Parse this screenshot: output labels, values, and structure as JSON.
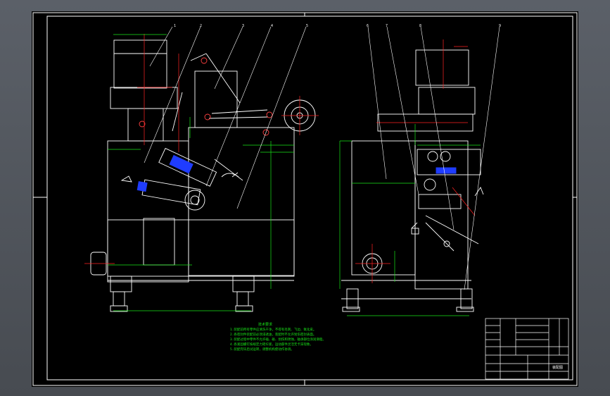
{
  "drawing": {
    "balloons_front": [
      "1",
      "2",
      "3",
      "4",
      "5"
    ],
    "balloons_side": [
      "6",
      "7",
      "8",
      "9"
    ],
    "notes_title": "技术要求",
    "notes_lines": [
      "1.装配前所有零件应清洗干净，不得有毛刺、飞边、氧化皮。",
      "2.各密封件装配前必须浸透油，装配时不允许划伤密封表面。",
      "3.装配过程中零件不允许磕、碰、划伤和锈蚀，轴承部位涂润滑脂。",
      "4.各紧固螺钉按规定力矩拧紧，运动部件灵活无卡滞现象。",
      "5.装配完毕后试运转，调整机构使动作协调。"
    ],
    "title_block_code": "装配图"
  },
  "colors": {
    "line": "#ffffff",
    "dim": "#19e619",
    "center": "#ff2222",
    "accent": "#1f3cff",
    "sheet": "#000000"
  }
}
